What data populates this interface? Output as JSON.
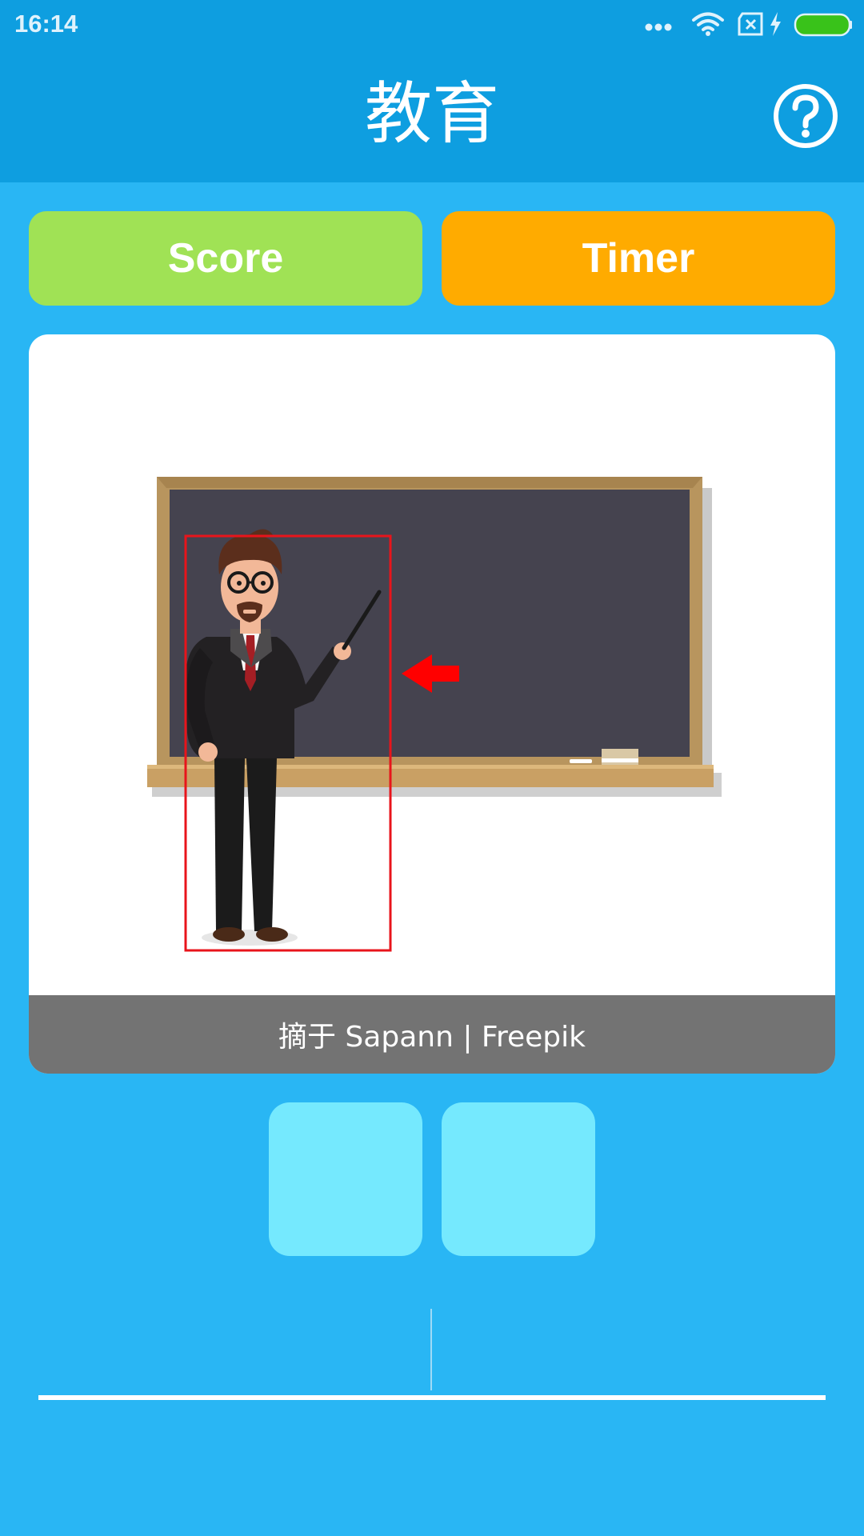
{
  "status_bar": {
    "time": "16:14",
    "icons": [
      "more-dots-icon",
      "wifi-icon",
      "no-sim-icon",
      "charging-icon",
      "battery-icon"
    ],
    "battery_color": "#39c21a"
  },
  "header": {
    "title": "教育",
    "help_icon": "question-circle-icon",
    "background": "#0e9ee0"
  },
  "buttons": {
    "score_label": "Score",
    "timer_label": "Timer",
    "score_color": "#a0e255",
    "timer_color": "#ffab00"
  },
  "image_card": {
    "caption": "摘于 Sapann | Freepik",
    "illustration": "teacher-at-blackboard",
    "highlight_color": "#e8141b"
  },
  "answer_tiles": [
    {
      "value": ""
    },
    {
      "value": ""
    }
  ],
  "answer_input": {
    "value": ""
  },
  "colors": {
    "page_background": "#29b6f4",
    "tile": "#75e9fe"
  }
}
